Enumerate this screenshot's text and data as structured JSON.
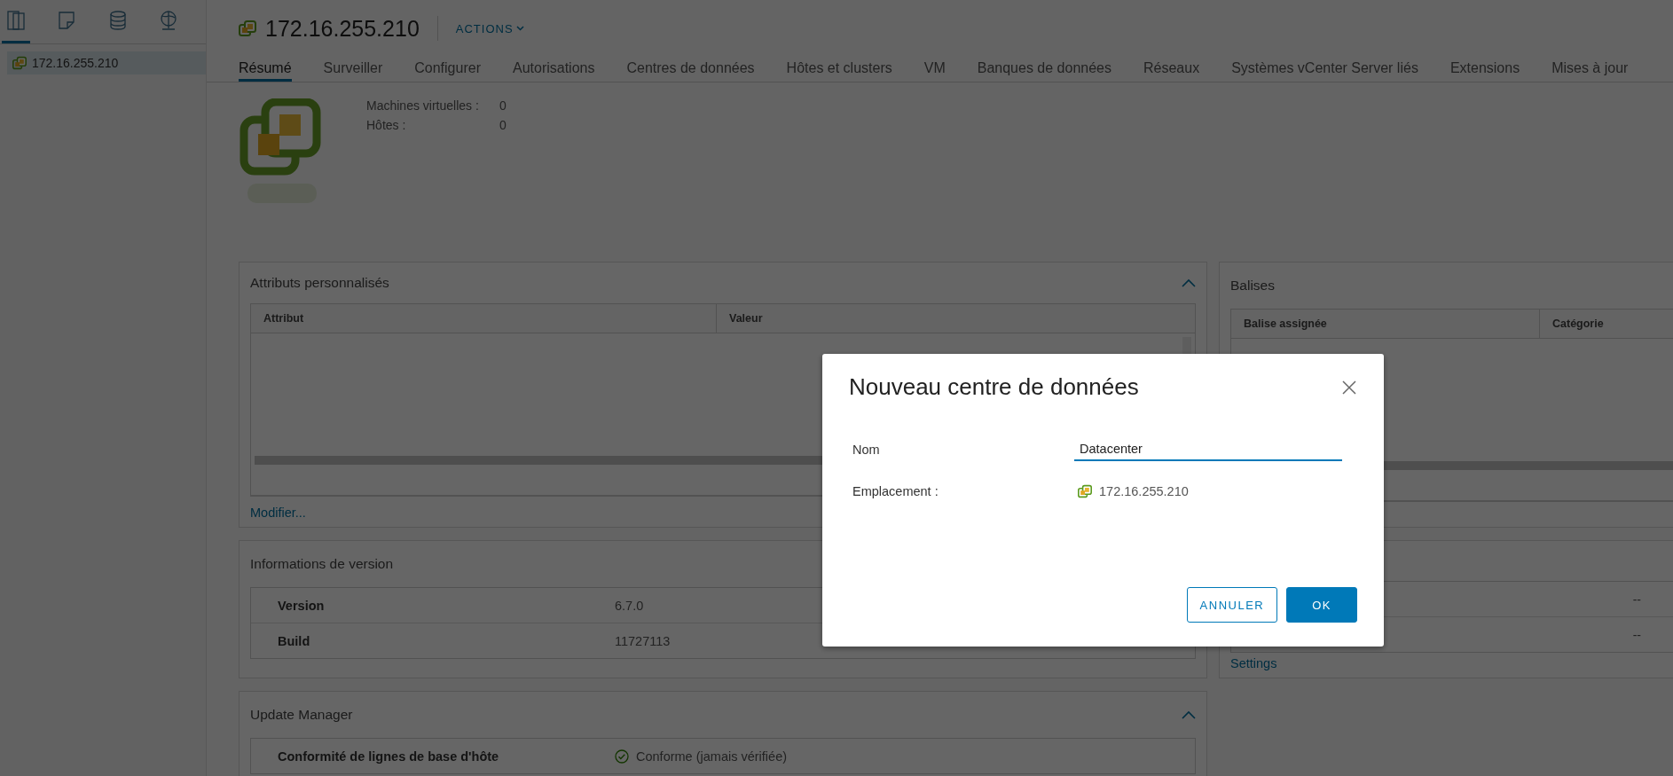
{
  "sidebar": {
    "tabs": [
      {
        "kind": "hosts",
        "selected": true
      },
      {
        "kind": "vms",
        "selected": false
      },
      {
        "kind": "storage",
        "selected": false
      },
      {
        "kind": "network",
        "selected": false
      }
    ],
    "tree": [
      {
        "label": "172.16.255.210",
        "selected": true
      }
    ]
  },
  "header": {
    "title": "172.16.255.210",
    "actions": "ACTIONS"
  },
  "tabs": [
    {
      "label": "Résumé",
      "selected": true
    },
    {
      "label": "Surveiller",
      "selected": false
    },
    {
      "label": "Configurer",
      "selected": false
    },
    {
      "label": "Autorisations",
      "selected": false
    },
    {
      "label": "Centres de données",
      "selected": false
    },
    {
      "label": "Hôtes et clusters",
      "selected": false
    },
    {
      "label": "VM",
      "selected": false
    },
    {
      "label": "Banques de données",
      "selected": false
    },
    {
      "label": "Réseaux",
      "selected": false
    },
    {
      "label": "Systèmes vCenter Server liés",
      "selected": false
    },
    {
      "label": "Extensions",
      "selected": false
    },
    {
      "label": "Mises à jour",
      "selected": false
    }
  ],
  "summary": {
    "stats": [
      {
        "label": "Machines virtuelles :",
        "value": "0"
      },
      {
        "label": "Hôtes :",
        "value": "0"
      }
    ]
  },
  "custom_attributes": {
    "title": "Attributs personnalisés",
    "expanded": true,
    "columns": [
      "Attribut",
      "Valeur"
    ],
    "link": "Modifier..."
  },
  "version_info": {
    "title": "Informations de version",
    "rows": [
      {
        "label": "Version",
        "value": "6.7.0"
      },
      {
        "label": "Build",
        "value": "11727113"
      }
    ]
  },
  "update_manager": {
    "title": "Update Manager",
    "expanded": true,
    "rows": [
      {
        "label": "Conformité de lignes de base d'hôte",
        "value": "Conforme (jamais vérifiée)"
      }
    ]
  },
  "tags": {
    "title": "Balises",
    "columns": [
      "Balise assignée",
      "Catégorie"
    ]
  },
  "right_panel": {
    "rows": [
      {
        "value": "--"
      },
      {
        "value": "--"
      }
    ],
    "link": "Settings"
  },
  "dialog": {
    "title": "Nouveau centre de données",
    "fields": [
      {
        "label": "Nom",
        "kind": "input",
        "value": "Datacenter"
      },
      {
        "label": "Emplacement :",
        "kind": "location",
        "value": "172.16.255.210"
      }
    ],
    "buttons": [
      {
        "label": "ANNULER",
        "kind": "secondary"
      },
      {
        "label": "OK",
        "kind": "primary"
      }
    ]
  }
}
